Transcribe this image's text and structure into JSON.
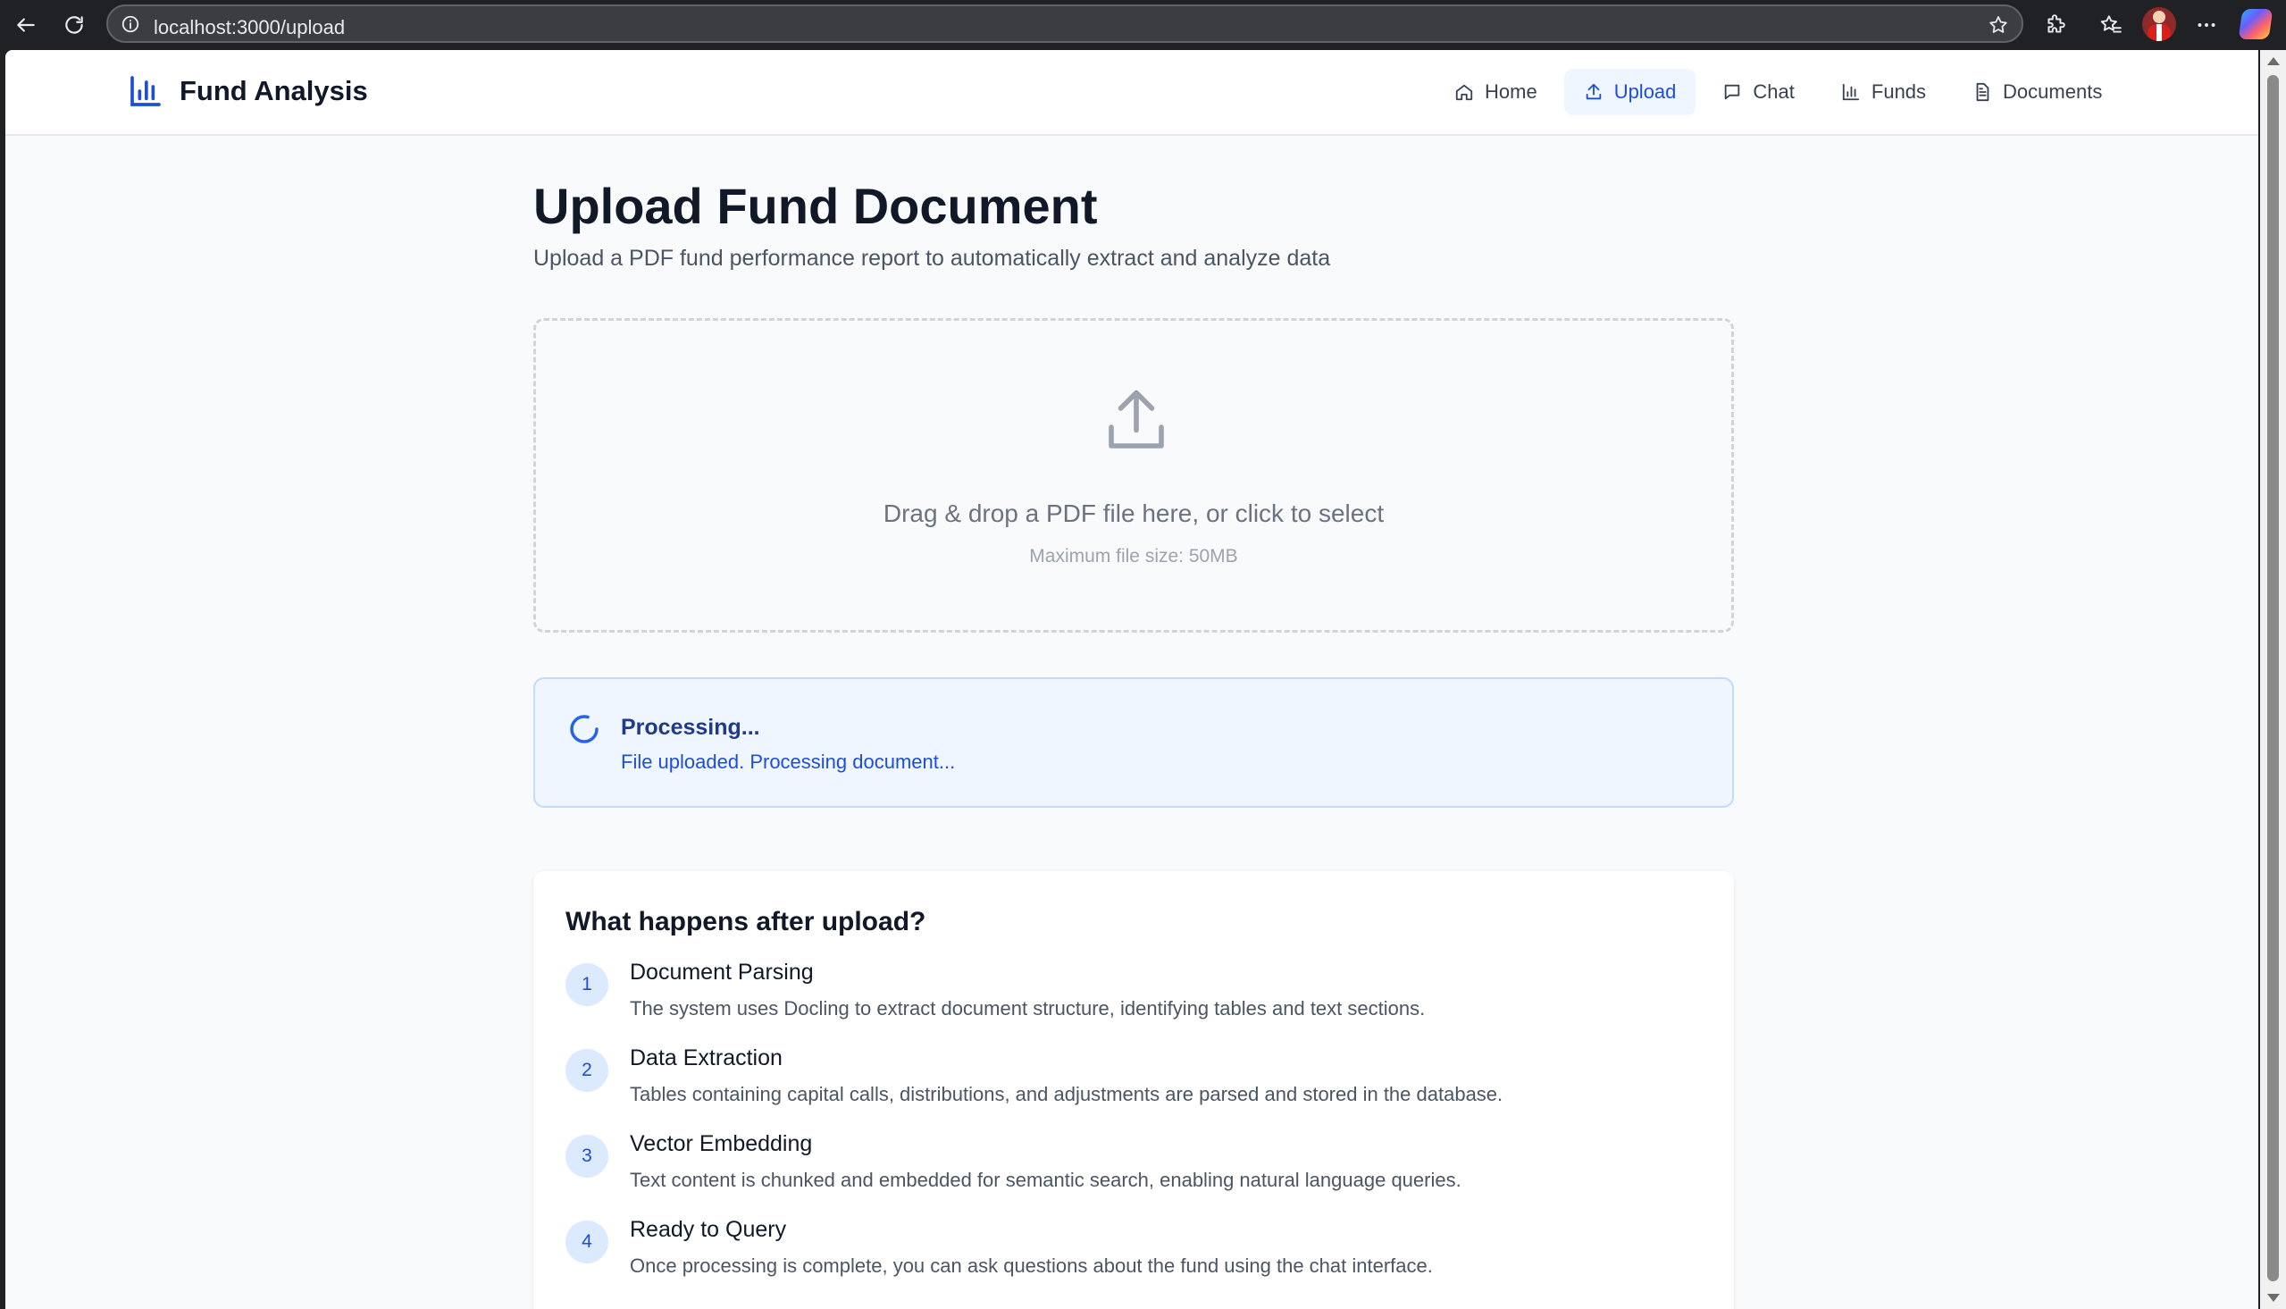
{
  "browser": {
    "url": "localhost:3000/upload"
  },
  "header": {
    "logo_text": "Fund Analysis",
    "nav": [
      {
        "label": "Home",
        "icon": "home-icon"
      },
      {
        "label": "Upload",
        "icon": "upload-icon",
        "active": true
      },
      {
        "label": "Chat",
        "icon": "chat-icon"
      },
      {
        "label": "Funds",
        "icon": "bar-chart-icon"
      },
      {
        "label": "Documents",
        "icon": "document-icon"
      }
    ]
  },
  "page": {
    "title": "Upload Fund Document",
    "subtitle": "Upload a PDF fund performance report to automatically extract and analyze data"
  },
  "dropzone": {
    "main_text": "Drag & drop a PDF file here, or click to select",
    "sub_text": "Maximum file size: 50MB"
  },
  "status": {
    "title": "Processing...",
    "message": "File uploaded. Processing document..."
  },
  "info": {
    "title": "What happens after upload?",
    "steps": [
      {
        "num": "1",
        "title": "Document Parsing",
        "desc": "The system uses Docling to extract document structure, identifying tables and text sections."
      },
      {
        "num": "2",
        "title": "Data Extraction",
        "desc": "Tables containing capital calls, distributions, and adjustments are parsed and stored in the database."
      },
      {
        "num": "3",
        "title": "Vector Embedding",
        "desc": "Text content is chunked and embedded for semantic search, enabling natural language queries."
      },
      {
        "num": "4",
        "title": "Ready to Query",
        "desc": "Once processing is complete, you can ask questions about the fund using the chat interface."
      }
    ]
  },
  "colors": {
    "accent": "#1d4ed8",
    "page_bg": "#f9fafb",
    "status_bg": "#eff6ff"
  }
}
